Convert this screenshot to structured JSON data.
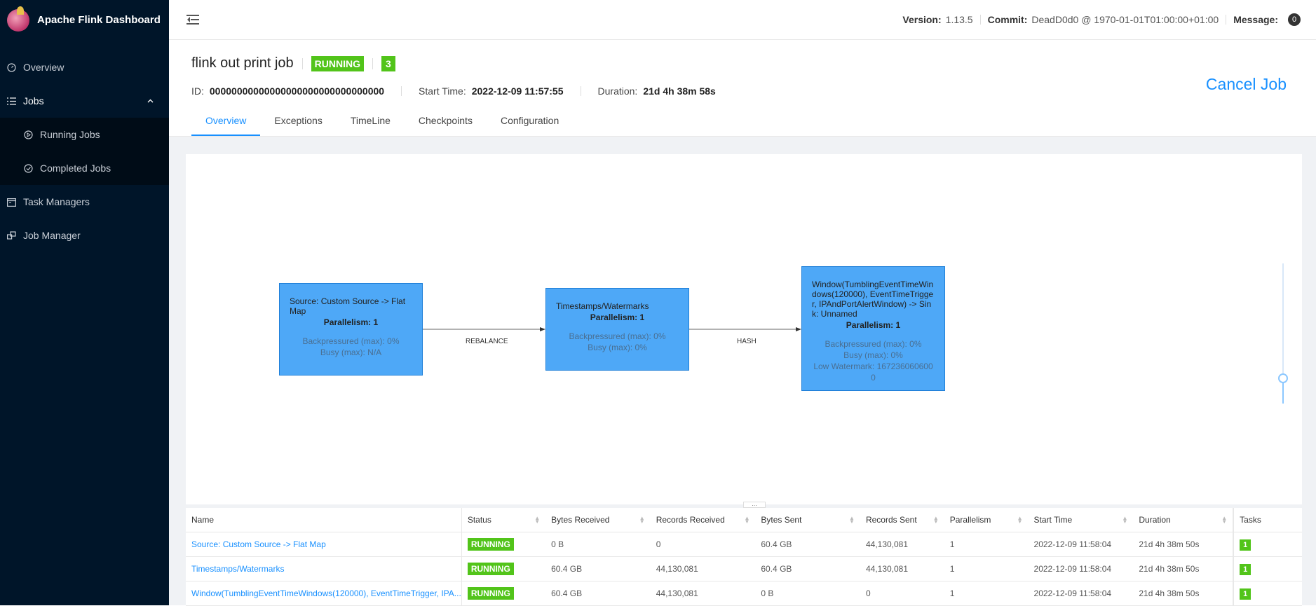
{
  "app": {
    "title": "Apache Flink Dashboard"
  },
  "sidebar": {
    "items": [
      {
        "label": "Overview"
      },
      {
        "label": "Jobs"
      },
      {
        "label": "Running Jobs"
      },
      {
        "label": "Completed Jobs"
      },
      {
        "label": "Task Managers"
      },
      {
        "label": "Job Manager"
      }
    ]
  },
  "header": {
    "version_label": "Version:",
    "version": "1.13.5",
    "commit_label": "Commit:",
    "commit": "DeadD0d0 @ 1970-01-01T01:00:00+01:00",
    "message_label": "Message:",
    "message_count": "0"
  },
  "job": {
    "title": "flink out print job",
    "status": "RUNNING",
    "task_count": "3",
    "id_label": "ID:",
    "id": "00000000000000000000000000000000",
    "start_label": "Start Time:",
    "start": "2022-12-09 11:57:55",
    "duration_label": "Duration:",
    "duration": "21d 4h 38m 58s",
    "cancel_label": "Cancel Job"
  },
  "tabs": [
    {
      "label": "Overview",
      "active": true
    },
    {
      "label": "Exceptions"
    },
    {
      "label": "TimeLine"
    },
    {
      "label": "Checkpoints"
    },
    {
      "label": "Configuration"
    }
  ],
  "graph": {
    "nodes": [
      {
        "title": "Source: Custom Source -> Flat Map",
        "parallelism": "Parallelism: 1",
        "stats": [
          "Backpressured (max): 0%",
          "Busy (max): N/A"
        ]
      },
      {
        "title": "Timestamps/Watermarks",
        "parallelism": "Parallelism: 1",
        "stats": [
          "Backpressured (max): 0%",
          "Busy (max): 0%"
        ]
      },
      {
        "title": "Window(TumblingEventTimeWindows(120000), EventTimeTrigger, IPAndPortAlertWindow) -> Sink: Unnamed",
        "parallelism": "Parallelism: 1",
        "stats": [
          "Backpressured (max): 0%",
          "Busy (max): 0%",
          "Low Watermark: 1672360606000"
        ]
      }
    ],
    "edges": [
      "REBALANCE",
      "HASH"
    ]
  },
  "table": {
    "columns": [
      "Name",
      "Status",
      "Bytes Received",
      "Records Received",
      "Bytes Sent",
      "Records Sent",
      "Parallelism",
      "Start Time",
      "Duration",
      "Tasks"
    ],
    "rows": [
      {
        "name": "Source: Custom Source -> Flat Map",
        "status": "RUNNING",
        "bytes_received": "0 B",
        "records_received": "0",
        "bytes_sent": "60.4 GB",
        "records_sent": "44,130,081",
        "parallelism": "1",
        "start_time": "2022-12-09 11:58:04",
        "duration": "21d 4h 38m 50s",
        "tasks": "1"
      },
      {
        "name": "Timestamps/Watermarks",
        "status": "RUNNING",
        "bytes_received": "60.4 GB",
        "records_received": "44,130,081",
        "bytes_sent": "60.4 GB",
        "records_sent": "44,130,081",
        "parallelism": "1",
        "start_time": "2022-12-09 11:58:04",
        "duration": "21d 4h 38m 50s",
        "tasks": "1"
      },
      {
        "name": "Window(TumblingEventTimeWindows(120000), EventTimeTrigger, IPA...",
        "status": "RUNNING",
        "bytes_received": "60.4 GB",
        "records_received": "44,130,081",
        "bytes_sent": "0 B",
        "records_sent": "0",
        "parallelism": "1",
        "start_time": "2022-12-09 11:58:04",
        "duration": "21d 4h 38m 50s",
        "tasks": "1"
      }
    ]
  },
  "colors": {
    "sidebar_bg": "#001529",
    "accent": "#1890ff",
    "running": "#52c41a",
    "node": "#4ea8f7"
  }
}
